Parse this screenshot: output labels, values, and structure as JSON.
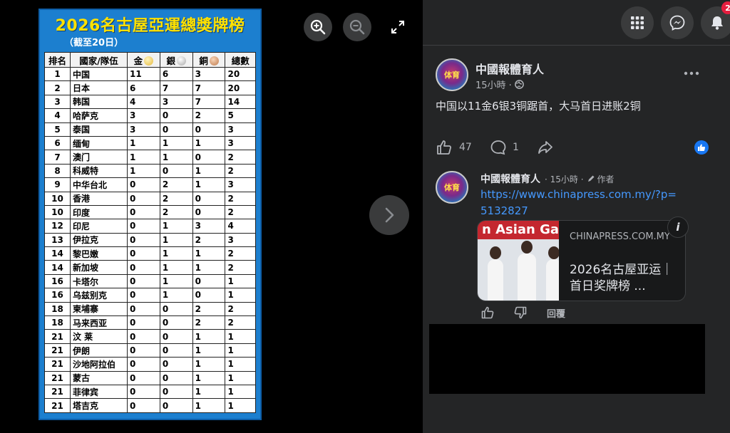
{
  "medal_table": {
    "title": "2026名古屋亞運總獎牌榜",
    "subtitle": "（截至20日）",
    "headers": {
      "rank": "排名",
      "country": "國家/隊伍",
      "gold": "金",
      "silver": "銀",
      "bronze": "銅",
      "total": "總數"
    },
    "rows": [
      {
        "rank": "1",
        "country": "中国",
        "gold": "11",
        "silver": "6",
        "bronze": "3",
        "total": "20"
      },
      {
        "rank": "2",
        "country": "日本",
        "gold": "6",
        "silver": "7",
        "bronze": "7",
        "total": "20"
      },
      {
        "rank": "3",
        "country": "韩国",
        "gold": "4",
        "silver": "3",
        "bronze": "7",
        "total": "14"
      },
      {
        "rank": "4",
        "country": "哈萨克",
        "gold": "3",
        "silver": "0",
        "bronze": "2",
        "total": "5"
      },
      {
        "rank": "5",
        "country": "泰国",
        "gold": "3",
        "silver": "0",
        "bronze": "0",
        "total": "3"
      },
      {
        "rank": "6",
        "country": "缅甸",
        "gold": "1",
        "silver": "1",
        "bronze": "1",
        "total": "3"
      },
      {
        "rank": "7",
        "country": "澳门",
        "gold": "1",
        "silver": "1",
        "bronze": "0",
        "total": "2"
      },
      {
        "rank": "8",
        "country": "科威特",
        "gold": "1",
        "silver": "0",
        "bronze": "1",
        "total": "2"
      },
      {
        "rank": "9",
        "country": "中华台北",
        "gold": "0",
        "silver": "2",
        "bronze": "1",
        "total": "3"
      },
      {
        "rank": "10",
        "country": "香港",
        "gold": "0",
        "silver": "2",
        "bronze": "0",
        "total": "2"
      },
      {
        "rank": "10",
        "country": "印度",
        "gold": "0",
        "silver": "2",
        "bronze": "0",
        "total": "2"
      },
      {
        "rank": "12",
        "country": "印尼",
        "gold": "0",
        "silver": "1",
        "bronze": "3",
        "total": "4"
      },
      {
        "rank": "13",
        "country": "伊拉克",
        "gold": "0",
        "silver": "1",
        "bronze": "2",
        "total": "3"
      },
      {
        "rank": "14",
        "country": "黎巴嫩",
        "gold": "0",
        "silver": "1",
        "bronze": "1",
        "total": "2"
      },
      {
        "rank": "14",
        "country": "新加坡",
        "gold": "0",
        "silver": "1",
        "bronze": "1",
        "total": "2"
      },
      {
        "rank": "16",
        "country": "卡塔尔",
        "gold": "0",
        "silver": "1",
        "bronze": "0",
        "total": "1"
      },
      {
        "rank": "16",
        "country": "乌兹别克",
        "gold": "0",
        "silver": "1",
        "bronze": "0",
        "total": "1"
      },
      {
        "rank": "18",
        "country": "柬埔寨",
        "gold": "0",
        "silver": "0",
        "bronze": "2",
        "total": "2"
      },
      {
        "rank": "18",
        "country": "马来西亚",
        "gold": "0",
        "silver": "0",
        "bronze": "2",
        "total": "2"
      },
      {
        "rank": "21",
        "country": "汶 莱",
        "gold": "0",
        "silver": "0",
        "bronze": "1",
        "total": "1"
      },
      {
        "rank": "21",
        "country": "伊朗",
        "gold": "0",
        "silver": "0",
        "bronze": "1",
        "total": "1"
      },
      {
        "rank": "21",
        "country": "沙地阿拉伯",
        "gold": "0",
        "silver": "0",
        "bronze": "1",
        "total": "1"
      },
      {
        "rank": "21",
        "country": "蒙古",
        "gold": "0",
        "silver": "0",
        "bronze": "1",
        "total": "1"
      },
      {
        "rank": "21",
        "country": "菲律宾",
        "gold": "0",
        "silver": "0",
        "bronze": "1",
        "total": "1"
      },
      {
        "rank": "21",
        "country": "塔吉克",
        "gold": "0",
        "silver": "0",
        "bronze": "1",
        "total": "1"
      }
    ]
  },
  "topbar": {
    "notification_count": "2"
  },
  "post": {
    "author": "中國報體育人",
    "time": "15小時 ·",
    "text": "中国以11金6银3铜踞首，大马首日进账2铜",
    "like_count": "47",
    "comment_count": "1",
    "avatar_text": "体育"
  },
  "comment": {
    "author": "中國報體育人",
    "time": "· 15小時 ·",
    "author_tag": "作者",
    "link": "https://www.chinapress.com.my/?p=5132827",
    "card": {
      "image_caption": "n Asian Ga",
      "domain": "CHINAPRESS.COM.MY",
      "title": "2026名古屋亚运｜首日奖牌榜 ..."
    },
    "reply_label": "回覆"
  },
  "colors": {
    "panel_bg": "#242526",
    "link": "#4599ff",
    "like_blue": "#1877f2",
    "title_yellow": "#ffe100",
    "board_blue": "#1c7fcf"
  }
}
